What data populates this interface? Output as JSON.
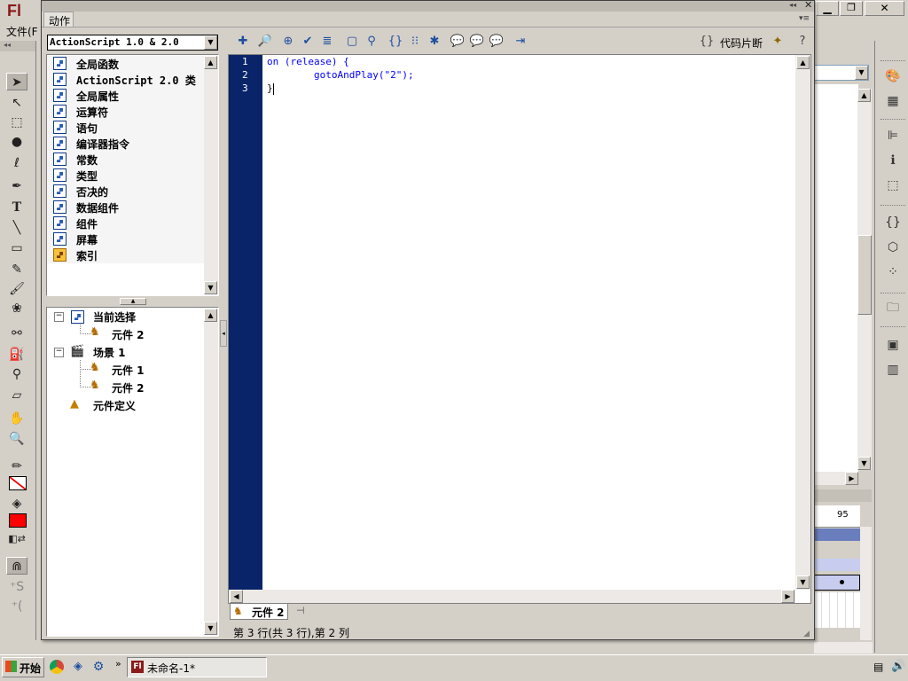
{
  "app": {
    "logo": "Fl",
    "menu_file": "文件(F"
  },
  "panel": {
    "title": "动作"
  },
  "version_select": {
    "value": "ActionScript 1.0 & 2.0"
  },
  "toolbar": {
    "code_snippets_label": "代码片断"
  },
  "books": [
    {
      "label": "全局函数",
      "icon": "book-icon"
    },
    {
      "label": "ActionScript 2.0 类",
      "icon": "book-icon"
    },
    {
      "label": "全局属性",
      "icon": "book-icon"
    },
    {
      "label": "运算符",
      "icon": "book-icon"
    },
    {
      "label": "语句",
      "icon": "book-icon"
    },
    {
      "label": "编译器指令",
      "icon": "book-icon"
    },
    {
      "label": "常数",
      "icon": "book-icon"
    },
    {
      "label": "类型",
      "icon": "book-icon"
    },
    {
      "label": "否决的",
      "icon": "book-icon"
    },
    {
      "label": "数据组件",
      "icon": "book-icon"
    },
    {
      "label": "组件",
      "icon": "book-icon"
    },
    {
      "label": "屏幕",
      "icon": "book-icon"
    },
    {
      "label": "索引",
      "icon": "index-icon"
    }
  ],
  "tree": {
    "current_selection": "当前选择",
    "current_child": "元件 2",
    "scene": "场景 1",
    "scene_children": [
      "元件 1",
      "元件 2"
    ],
    "symbol_definitions": "元件定义"
  },
  "editor": {
    "line_numbers": [
      "1",
      "2",
      "3"
    ],
    "lines": [
      "on (release) {",
      "        gotoAndPlay(\"2\");",
      "}"
    ]
  },
  "script_tab": {
    "label": "元件 2"
  },
  "status": {
    "text": "第 3 行(共 3 行),第 2 列"
  },
  "timeline": {
    "frame_label": "95"
  },
  "taskbar": {
    "start": "开始",
    "task": "未命名-1*"
  },
  "colors": {
    "gutter": "#0a246a",
    "stroke": "#000000",
    "fill": "#ff0000",
    "keyword": "#0000ff",
    "string": "#009900"
  }
}
